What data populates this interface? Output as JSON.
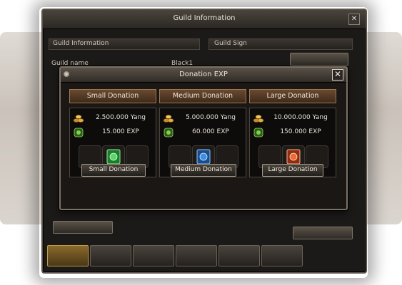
{
  "guild_window": {
    "title": "Guild Information",
    "section_info": "Guild Information",
    "section_sign": "Guild Sign",
    "guild_name_label": "Guild name",
    "guild_name_value": "Black1"
  },
  "donation_dialog": {
    "title": "Donation EXP",
    "options": [
      {
        "header": "Small Donation",
        "yang": "2.500.000 Yang",
        "exp": "15.000 EXP",
        "button": "Small Donation",
        "item_color": "#37b44a"
      },
      {
        "header": "Medium Donation",
        "yang": "5.000.000 Yang",
        "exp": "60.000 EXP",
        "button": "Medium Donation",
        "item_color": "#2f7fd6"
      },
      {
        "header": "Large Donation",
        "yang": "10.000.000 Yang",
        "exp": "150.000 EXP",
        "button": "Large Donation",
        "item_color": "#e0542a"
      }
    ]
  },
  "icons": {
    "yang": "coin-stack-icon",
    "exp": "exp-dragon-icon",
    "close": "close-icon"
  },
  "colors": {
    "header_brown": "#5a3c24",
    "gold_coin": "#d9a63a",
    "exp_green": "#5fbf3a"
  }
}
